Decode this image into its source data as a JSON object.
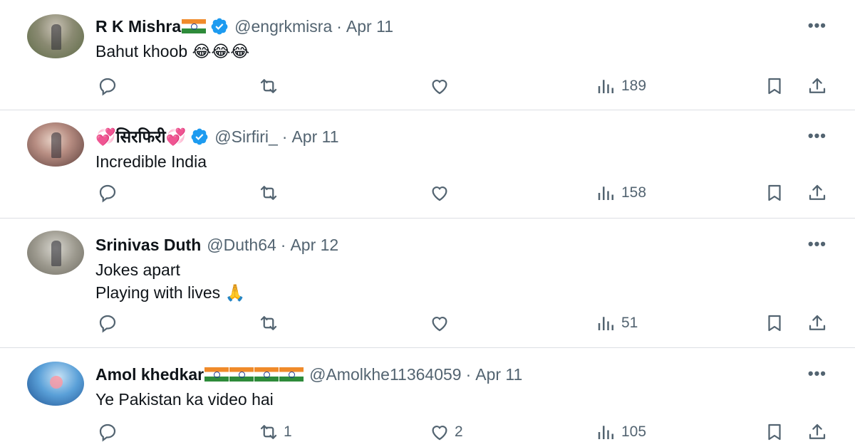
{
  "tweets": [
    {
      "name": "R K Mishra",
      "name_suffix_flags": 1,
      "verified": true,
      "handle": "@engrkmisra",
      "date": "Apr 11",
      "text": "Bahut khoob 😂😂😂",
      "replies": "",
      "retweets": "",
      "likes": "",
      "views": "189"
    },
    {
      "name": "💞सिरफिरी💞",
      "name_suffix_flags": 0,
      "verified": true,
      "handle": "@Sirfiri_",
      "date": "Apr 11",
      "text": "Incredible India",
      "replies": "",
      "retweets": "",
      "likes": "",
      "views": "158"
    },
    {
      "name": "Srinivas Duth",
      "name_suffix_flags": 0,
      "verified": false,
      "handle": "@Duth64",
      "date": "Apr 12",
      "text": "Jokes apart\nPlaying with lives 🙏",
      "replies": "",
      "retweets": "",
      "likes": "",
      "views": "51"
    },
    {
      "name": "Amol khedkar",
      "name_suffix_flags": 4,
      "verified": false,
      "handle": "@Amolkhe11364059",
      "date": "Apr 11",
      "text": "Ye Pakistan ka video hai",
      "replies": "",
      "retweets": "1",
      "likes": "2",
      "views": "105"
    }
  ],
  "separator": "·",
  "more_label": "•••",
  "icons": {
    "reply": "reply-icon",
    "retweet": "retweet-icon",
    "like": "heart-icon",
    "views": "views-icon",
    "bookmark": "bookmark-icon",
    "share": "share-icon",
    "verified": "verified-badge-icon"
  },
  "colors": {
    "text": "#0f1419",
    "secondary": "#536471",
    "verified": "#1d9bf0",
    "divider": "#dcdfe3"
  }
}
